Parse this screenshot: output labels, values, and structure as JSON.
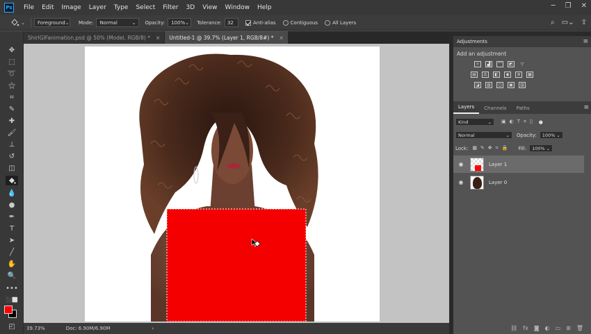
{
  "app": {
    "logo": "Ps"
  },
  "menubar": {
    "items": [
      "File",
      "Edit",
      "Image",
      "Layer",
      "Type",
      "Select",
      "Filter",
      "3D",
      "View",
      "Window",
      "Help"
    ]
  },
  "options": {
    "fill_source": "Foreground",
    "mode_label": "Mode:",
    "mode_value": "Normal",
    "opacity_label": "Opacity:",
    "opacity_value": "100%",
    "tolerance_label": "Tolerance:",
    "tolerance_value": "32",
    "antialias_label": "Anti-alias",
    "antialias_checked": true,
    "contiguous_label": "Contiguous",
    "alllayers_label": "All Layers"
  },
  "tabs": [
    {
      "label": "ShirlGIFanimation.psd @ 50% (Model, RGB/8) *",
      "active": false
    },
    {
      "label": "Untitled-1 @ 39.7% (Layer 1, RGB/8#) *",
      "active": true
    }
  ],
  "status": {
    "zoom": "39.73%",
    "doc": "Doc: 6.90M/6.90M"
  },
  "colors": {
    "foreground": "#ff0000",
    "background": "#000000",
    "fill_rect": "#f50000"
  },
  "adjustments": {
    "panel_title": "Adjustments",
    "subtitle": "Add an adjustment"
  },
  "layers_panel": {
    "tabs": [
      "Layers",
      "Channels",
      "Paths"
    ],
    "filter_kind": "Kind",
    "blend_mode": "Normal",
    "opacity_label": "Opacity:",
    "opacity_value": "100%",
    "lock_label": "Lock:",
    "fill_label": "Fill:",
    "fill_value": "100%",
    "layers": [
      {
        "name": "Layer 1",
        "selected": true
      },
      {
        "name": "Layer 0",
        "selected": false
      }
    ]
  }
}
